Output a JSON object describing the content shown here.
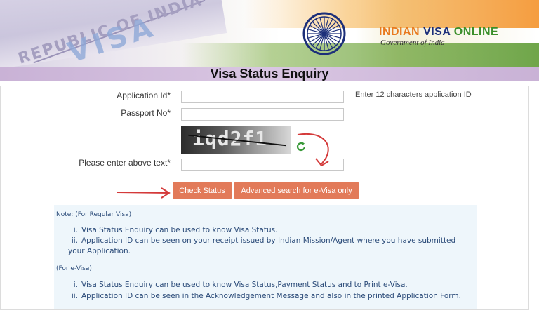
{
  "banner": {
    "passport_text": "REPUBLIC OF INDIA",
    "visa_text": "VISA",
    "brand_word1": "INDIAN",
    "brand_word2": "VISA",
    "brand_word3": "ONLINE",
    "subtitle": "Government of India"
  },
  "page": {
    "title": "Visa Status Enquiry"
  },
  "form": {
    "application_id_label": "Application Id*",
    "application_id_value": "",
    "application_id_hint": "Enter 12 characters application ID",
    "passport_label": "Passport No*",
    "passport_value": "",
    "captcha_text": "iqd2f1",
    "captcha_label": "Please enter above text*",
    "captcha_value": "",
    "check_status_label": "Check Status",
    "advanced_search_label": "Advanced search for e-Visa only"
  },
  "note": {
    "regular_heading": "Note: (For Regular Visa)",
    "regular_items": [
      {
        "num": "i.",
        "text": "Visa Status Enquiry can be used to know Visa Status."
      },
      {
        "num": "ii.",
        "text": "Application ID can be seen on your receipt issued by Indian Mission/Agent where you have submitted your Application."
      }
    ],
    "evisa_heading": "(For e-Visa)",
    "evisa_items": [
      {
        "num": "i.",
        "text": "Visa Status Enquiry can be used to know Visa Status,Payment Status and to Print e-Visa."
      },
      {
        "num": "ii.",
        "text": "Application ID can be seen in the Acknowledgement Message and also in the printed Application Form."
      }
    ]
  },
  "colors": {
    "button": "#e27a59",
    "annotation_arrow": "#d43a3a",
    "note_text": "#2a4a78",
    "title_bar": "#d9c6e2"
  },
  "icons": {
    "emblem": "ashoka-chakra-icon",
    "refresh": "refresh-icon"
  }
}
